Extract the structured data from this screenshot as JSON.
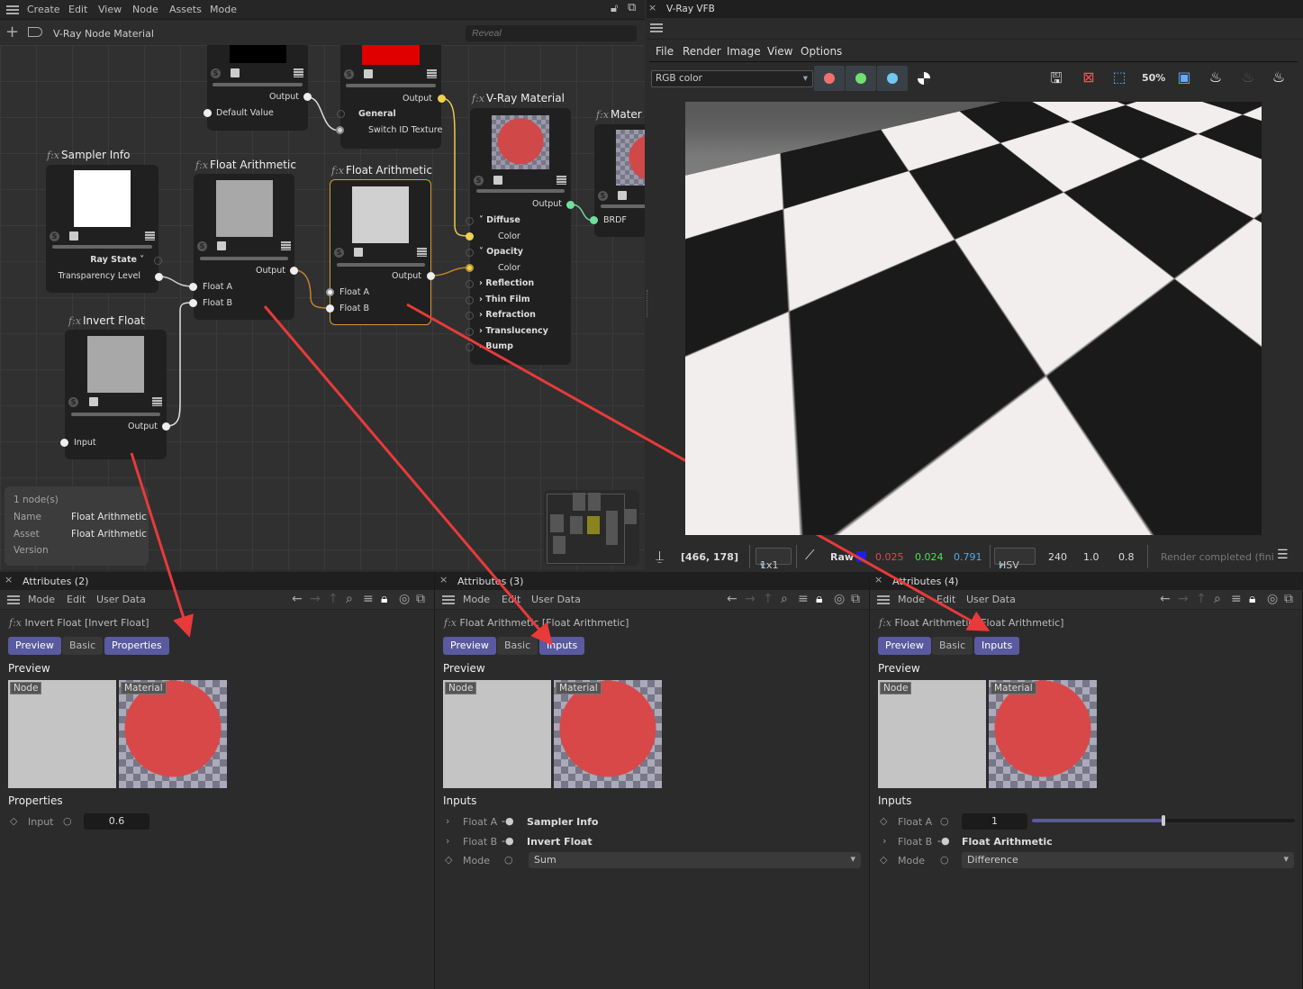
{
  "node_editor": {
    "menu": [
      "Create",
      "Edit",
      "View",
      "Node",
      "Assets",
      "Mode"
    ],
    "breadcrumb": "V-Ray Node Material",
    "reveal_placeholder": "Reveal",
    "nodes": {
      "top_a": {
        "output": "Output",
        "input": "Default Value"
      },
      "top_b": {
        "output": "Output",
        "group": "General",
        "input": "Switch ID Texture"
      },
      "vray_material": {
        "title": "V-Ray Material",
        "output": "Output",
        "ports": [
          "Diffuse",
          "Color",
          "Opacity",
          "Color",
          "Reflection",
          "Thin Film",
          "Refraction",
          "Translucency",
          "Bump"
        ]
      },
      "material": {
        "title": "Mater",
        "input": "BRDF"
      },
      "sampler_info": {
        "title": "Sampler Info",
        "group": "Ray State",
        "output": "Transparency Level"
      },
      "float_arith_1": {
        "title": "Float Arithmetic",
        "output": "Output",
        "inputs": [
          "Float A",
          "Float B"
        ]
      },
      "float_arith_2": {
        "title": "Float Arithmetic",
        "output": "Output",
        "inputs": [
          "Float A",
          "Float B"
        ]
      },
      "invert_float": {
        "title": "Invert Float",
        "output": "Output",
        "input": "Input"
      }
    },
    "fx_glyph": "f:x",
    "info": {
      "count": "1 node(s)",
      "name_label": "Name",
      "name": "Float Arithmetic",
      "asset_label": "Asset",
      "asset": "Float Arithmetic",
      "version_label": "Version"
    }
  },
  "vfb": {
    "title": "V-Ray VFB",
    "menu": [
      "File",
      "Render",
      "Image",
      "View",
      "Options"
    ],
    "channel": "RGB color",
    "status": {
      "coords": "[466, 178]",
      "sampling": "1x1",
      "mode": "Raw",
      "r": "0.025",
      "g": "0.024",
      "b": "0.791",
      "colorspace": "HSV",
      "h": "240",
      "s": "1.0",
      "v": "0.8",
      "message": "Render completed (fini"
    },
    "colors": {
      "red": "#f07070",
      "green": "#70e070",
      "blue": "#70c8f0"
    }
  },
  "panels": [
    {
      "header": "Attributes (2)",
      "menu": [
        "Mode",
        "Edit",
        "User Data"
      ],
      "title": "Invert Float [Invert Float]",
      "tabs": [
        "Preview",
        "Basic",
        "Properties"
      ],
      "preview_label": "Preview",
      "node_tag": "Node",
      "material_tag": "Material",
      "section": "Properties",
      "rows": [
        {
          "label": "Input",
          "value": "0.6"
        }
      ]
    },
    {
      "header": "Attributes (3)",
      "menu": [
        "Mode",
        "Edit",
        "User Data"
      ],
      "title": "Float Arithmetic [Float Arithmetic]",
      "tabs": [
        "Preview",
        "Basic",
        "Inputs"
      ],
      "preview_label": "Preview",
      "node_tag": "Node",
      "material_tag": "Material",
      "section": "Inputs",
      "rows": [
        {
          "label": "Float A",
          "value": "Sampler Info"
        },
        {
          "label": "Float B",
          "value": "Invert Float"
        },
        {
          "label": "Mode",
          "value": "Sum"
        }
      ]
    },
    {
      "header": "Attributes (4)",
      "menu": [
        "Mode",
        "Edit",
        "User Data"
      ],
      "title": "Float Arithmetic [Float Arithmetic]",
      "tabs": [
        "Preview",
        "Basic",
        "Inputs"
      ],
      "preview_label": "Preview",
      "node_tag": "Node",
      "material_tag": "Material",
      "section": "Inputs",
      "rows": [
        {
          "label": "Float A",
          "value": "1",
          "slider": 0.5
        },
        {
          "label": "Float B",
          "value": "Float Arithmetic"
        },
        {
          "label": "Mode",
          "value": "Difference"
        }
      ]
    }
  ],
  "accent": "#5a5aa0",
  "annotation_color": "#e83a3a"
}
